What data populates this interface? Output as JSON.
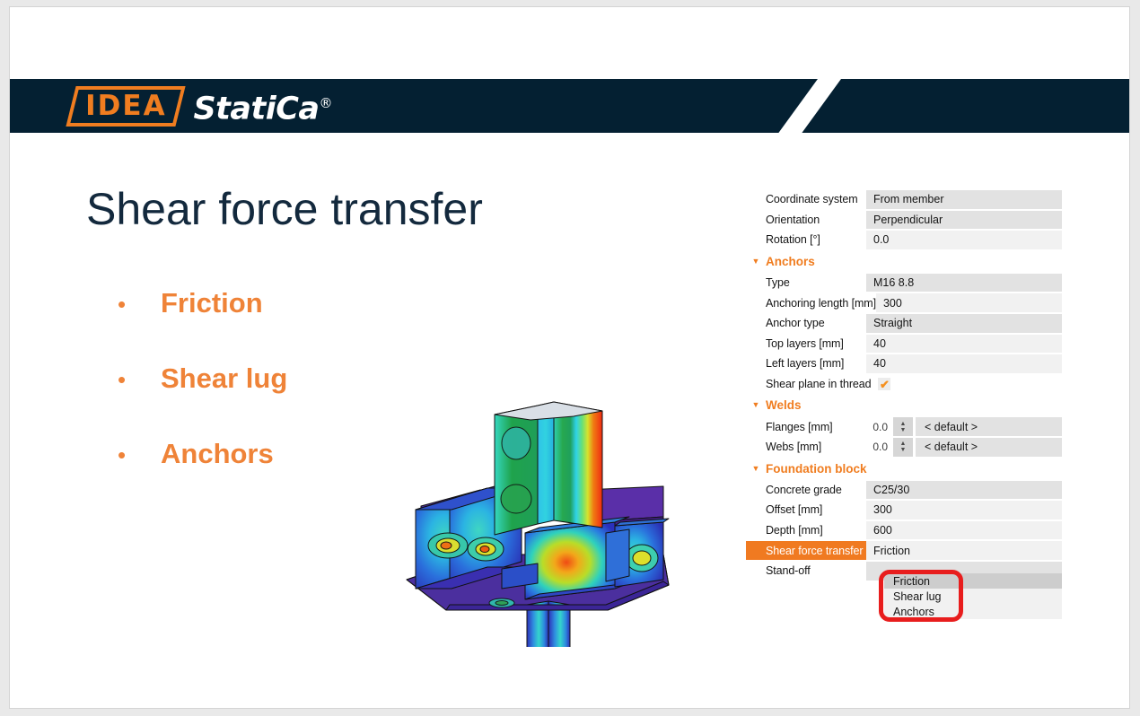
{
  "slide": {
    "title": "Shear force transfer",
    "bullets": [
      {
        "label": "Friction"
      },
      {
        "label": "Shear lug"
      },
      {
        "label": "Anchors"
      }
    ],
    "bullet_marker": "•"
  },
  "brand": {
    "logo_mark": "IDEA",
    "logo_word": "StatiCa",
    "logo_registered": "®",
    "navy": "#042032",
    "orange": "#f07d20"
  },
  "model": {
    "caption": "3D FEA stress plot of steel column base / beam connection"
  },
  "properties": {
    "triangle_glyph": "▼",
    "check_glyph": "✔",
    "spin_up": "▲",
    "spin_down": "▼",
    "rows": [
      {
        "label": "Coordinate system",
        "value": "From member",
        "kind": "combo"
      },
      {
        "label": "Orientation",
        "value": "Perpendicular",
        "kind": "combo"
      },
      {
        "label": "Rotation [°]",
        "value": "0.0",
        "kind": "input"
      },
      {
        "section": "Anchors"
      },
      {
        "label": "Type",
        "value": "M16 8.8",
        "kind": "combo"
      },
      {
        "label": "Anchoring length [mm]",
        "value": "300",
        "kind": "input"
      },
      {
        "label": "Anchor type",
        "value": "Straight",
        "kind": "combo"
      },
      {
        "label": "Top layers [mm]",
        "value": "40",
        "kind": "input"
      },
      {
        "label": "Left layers [mm]",
        "value": "40",
        "kind": "input"
      },
      {
        "label": "Shear plane in thread",
        "value": "",
        "kind": "checkbox",
        "checked": true
      },
      {
        "section": "Welds"
      },
      {
        "label": "Flanges [mm]",
        "value": "< default >",
        "number": "0.0",
        "kind": "spinner"
      },
      {
        "label": "Webs [mm]",
        "value": "< default >",
        "number": "0.0",
        "kind": "spinner"
      },
      {
        "section": "Foundation block"
      },
      {
        "label": "Concrete grade",
        "value": "C25/30",
        "kind": "combo"
      },
      {
        "label": "Offset [mm]",
        "value": "300",
        "kind": "input"
      },
      {
        "label": "Depth [mm]",
        "value": "600",
        "kind": "input"
      },
      {
        "label": "Shear force transfer",
        "value": "Friction",
        "kind": "input",
        "label_highlight": true
      },
      {
        "label": "Stand-off",
        "value": "",
        "kind": "combo"
      }
    ]
  },
  "dropdown": {
    "highlight_color": "#e81d1d",
    "options": [
      {
        "label": "Friction",
        "selected": true
      },
      {
        "label": "Shear lug",
        "selected": false
      },
      {
        "label": "Anchors",
        "selected": false
      }
    ]
  }
}
